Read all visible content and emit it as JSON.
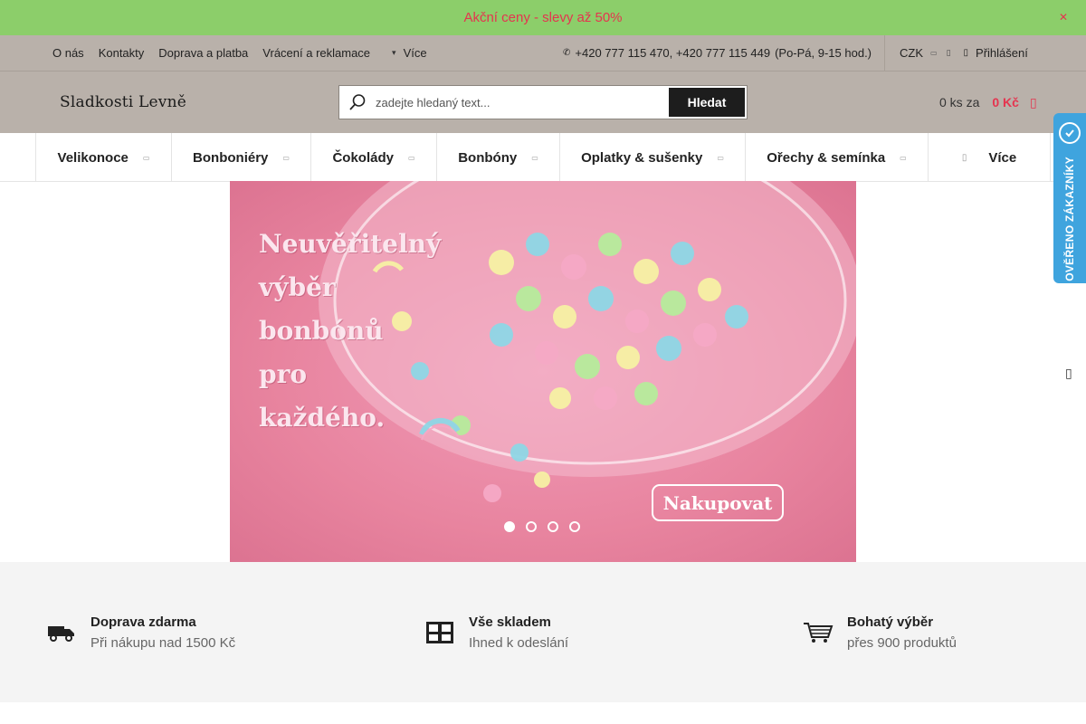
{
  "promo": {
    "text": "Akční ceny - slevy až 50%",
    "close_icon": "close-icon",
    "background": "#8cce6a",
    "text_color": "#e5344f"
  },
  "topnav": {
    "links": [
      "O nás",
      "Kontakty",
      "Doprava a platba",
      "Vrácení a reklamace"
    ],
    "more_label": "Více",
    "phone": "+420 777 115 470, +420 777 115 449",
    "hours": "(Po-Pá, 9-15 hod.)",
    "currency": "CZK",
    "login": "Přihlášení"
  },
  "header": {
    "logo_text": "Sladkosti Levně",
    "search_placeholder": "zadejte hledaný text...",
    "search_button": "Hledat",
    "cart_qty": "0 ks za",
    "cart_price": "0 Kč",
    "background": "#b9b1aa",
    "accent": "#e5344f"
  },
  "menu": {
    "items": [
      {
        "label": "Velikonoce"
      },
      {
        "label": "Bonboniéry"
      },
      {
        "label": "Čokolády"
      },
      {
        "label": "Bonbóny"
      },
      {
        "label": "Oplatky & sušenky"
      },
      {
        "label": "Ořechy & semínka"
      }
    ],
    "more_label": "Více"
  },
  "hero": {
    "lines": [
      "Neuvěřitelný",
      "výběr",
      "bonbónů",
      "pro",
      "každého."
    ],
    "cta": "Nakupovat",
    "slides": 4,
    "active_slide": 1
  },
  "verified_badge": {
    "text": "OVĚŘENO ZÁKAZNÍKY",
    "color": "#3fa4de"
  },
  "features": [
    {
      "title": "Doprava zdarma",
      "subtitle": "Při nákupu nad 1500 Kč",
      "icon": "truck-icon"
    },
    {
      "title": "Vše skladem",
      "subtitle": "Ihned k odeslání",
      "icon": "warehouse-icon"
    },
    {
      "title": "Bohatý výběr",
      "subtitle": "přes 900 produktů",
      "icon": "cart-icon"
    }
  ]
}
